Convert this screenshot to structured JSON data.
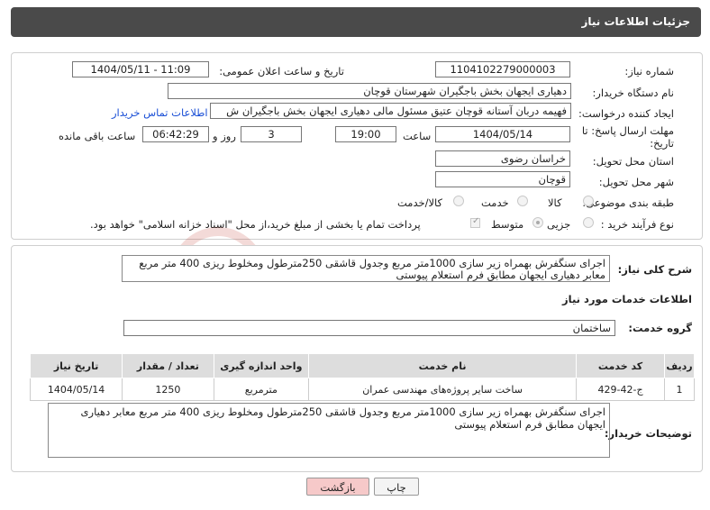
{
  "header": {
    "title": "جزئیات اطلاعات نیاز"
  },
  "form": {
    "need_number_label": "شماره نیاز:",
    "need_number": "1104102279000003",
    "announce_label": "تاریخ و ساعت اعلان عمومی:",
    "announce_value": "1404/05/11 - 11:09",
    "buyer_org_label": "نام دستگاه خریدار:",
    "buyer_org": "دهیاری ایجهان بخش باجگیران شهرستان قوچان",
    "creator_label": "ایجاد کننده درخواست:",
    "creator": "فهیمه دربان آستانه قوچان عتیق مسئول مالی دهیاری ایجهان بخش باجگیران ش",
    "contact_link": "اطلاعات تماس خریدار",
    "deadline_label": "مهلت ارسال پاسخ: تا",
    "deadline_label2": "تاریخ:",
    "deadline_date": "1404/05/14",
    "time_label": "ساعت",
    "deadline_time": "19:00",
    "days_value": "3",
    "days_label": "روز و",
    "remaining_time": "06:42:29",
    "remaining_label": "ساعت باقی مانده",
    "province_label": "استان محل تحویل:",
    "province": "خراسان رضوی",
    "city_label": "شهر محل تحویل:",
    "city": "قوچان",
    "category_label": "طبقه بندی موضوعی:",
    "category_options": [
      "کالا",
      "خدمت",
      "کالا/خدمت"
    ],
    "process_label": "نوع فرآیند خرید :",
    "process_options": [
      "جزیی",
      "متوسط"
    ],
    "payment_note": "پرداخت تمام یا بخشی از مبلغ خرید،از محل \"اسناد خزانه اسلامی\" خواهد بود."
  },
  "description": {
    "label": "شرح کلی نیاز:",
    "text": "اجرای سنگفرش بهمراه زیر سازی 1000متر مربع وجدول قاشقی 250مترطول ومخلوط ریزی 400 متر مربع معابر دهیاری ایجهان مطابق فرم استعلام پیوستی"
  },
  "services": {
    "section_title": "اطلاعات خدمات مورد نیاز",
    "group_label": "گروه خدمت:",
    "group_value": "ساختمان",
    "columns": [
      "ردیف",
      "کد خدمت",
      "نام خدمت",
      "واحد اندازه گیری",
      "تعداد / مقدار",
      "تاریخ نیاز"
    ],
    "rows": [
      [
        "1",
        "ج-42-429",
        "ساخت سایر پروژه‌های مهندسی عمران",
        "مترمربع",
        "1250",
        "1404/05/14"
      ]
    ]
  },
  "buyer_notes": {
    "label": "توضیحات خریدار:",
    "text": "اجرای سنگفرش بهمراه زیر سازی 1000متر مربع وجدول قاشقی 250مترطول ومخلوط ریزی 400 متر مربع معابر دهیاری ایجهان مطابق فرم استعلام پیوستی"
  },
  "buttons": {
    "print": "چاپ",
    "back": "بازگشت"
  },
  "colors": {
    "header_bg": "#4a4a4a",
    "back_button_bg": "#f6c9c9",
    "link": "#1a4fd6",
    "watermark": "#c0392b"
  }
}
